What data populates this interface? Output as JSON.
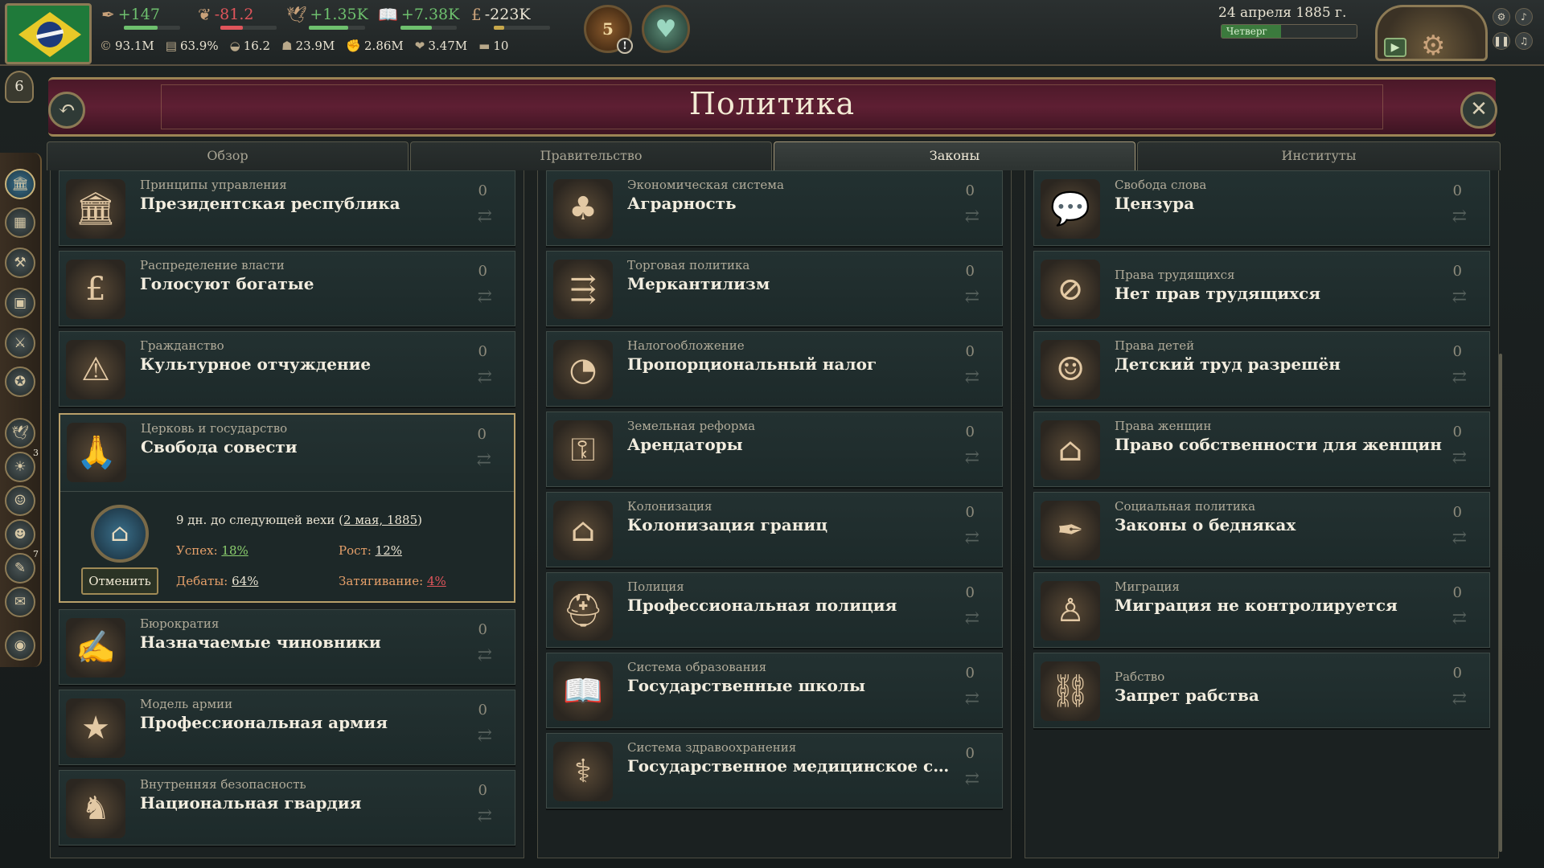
{
  "topbar": {
    "country_flag": "brazil-flag",
    "resources": [
      {
        "icon": "authority-icon",
        "value": "+147",
        "color": "#6ec06e"
      },
      {
        "icon": "bureaucracy-icon",
        "value": "-81.2",
        "color": "#e0555b"
      },
      {
        "icon": "influence-icon",
        "value": "+1.35K",
        "color": "#6ec06e"
      },
      {
        "icon": "innovation-icon",
        "value": "+7.38K",
        "color": "#6ec06e"
      },
      {
        "icon": "treasury-icon",
        "value": "-223K",
        "color": "#e9e3d2"
      }
    ],
    "stats": [
      {
        "icon": "gdp-icon",
        "value": "93.1M"
      },
      {
        "icon": "literacy-icon",
        "value": "63.9%"
      },
      {
        "icon": "sol-icon",
        "value": "16.2"
      },
      {
        "icon": "population-icon",
        "value": "23.9M"
      },
      {
        "icon": "loyalists-icon",
        "value": "2.86M"
      },
      {
        "icon": "radicals-icon",
        "value": "3.47M"
      },
      {
        "icon": "army-icon",
        "value": "10"
      }
    ],
    "journal_count": "5",
    "date": "24 апреля 1885 г.",
    "weekday": "Четверг",
    "rank": "6"
  },
  "page": {
    "title": "Политика"
  },
  "tabs": [
    {
      "label": "Обзор",
      "active": false
    },
    {
      "label": "Правительство",
      "active": false
    },
    {
      "label": "Законы",
      "active": true
    },
    {
      "label": "Институты",
      "active": false
    }
  ],
  "columns": [
    {
      "laws": [
        {
          "category": "Принципы управления",
          "name": "Президентская республика",
          "count": "0",
          "icon": "institution-icon"
        },
        {
          "category": "Распределение власти",
          "name": "Голосуют богатые",
          "count": "0",
          "icon": "pound-icon"
        },
        {
          "category": "Гражданство",
          "name": "Культурное отчуждение",
          "count": "0",
          "icon": "hand-warning-icon"
        },
        {
          "category": "Бюрократия",
          "name": "Назначаемые чиновники",
          "count": "0",
          "icon": "quill-hand-icon"
        },
        {
          "category": "Модель армии",
          "name": "Профессиональная армия",
          "count": "0",
          "icon": "star-medal-icon"
        },
        {
          "category": "Внутренняя безопасность",
          "name": "Национальная гвардия",
          "count": "0",
          "icon": "soldiers-icon"
        }
      ],
      "expanded": {
        "category": "Церковь и государство",
        "name": "Свобода совести",
        "count": "0",
        "icon": "praying-hands-icon",
        "milestone_text": "9 дн. до следующей вехи (",
        "milestone_date": "2 мая, 1885",
        "milestone_end": ")",
        "success_label": "Успех:",
        "success_value": "18%",
        "growth_label": "Рост:",
        "growth_value": "12%",
        "debate_label": "Дебаты:",
        "debate_value": "64%",
        "stall_label": "Затягивание:",
        "stall_value": "4%",
        "cancel_label": "Отменить"
      }
    },
    {
      "laws": [
        {
          "category": "Экономическая система",
          "name": "Аграрность",
          "count": "0",
          "icon": "farmer-icon"
        },
        {
          "category": "Торговая политика",
          "name": "Меркантилизм",
          "count": "0",
          "icon": "trade-arrows-icon"
        },
        {
          "category": "Налогообложение",
          "name": "Пропорциональный налог",
          "count": "0",
          "icon": "pie-icon"
        },
        {
          "category": "Земельная реформа",
          "name": "Арендаторы",
          "count": "0",
          "icon": "key-hand-icon"
        },
        {
          "category": "Колонизация",
          "name": "Колонизация границ",
          "count": "0",
          "icon": "house-icon"
        },
        {
          "category": "Полиция",
          "name": "Профессиональная полиция",
          "count": "0",
          "icon": "police-helmet-icon"
        },
        {
          "category": "Система образования",
          "name": "Государственные школы",
          "count": "0",
          "icon": "book-icon"
        },
        {
          "category": "Система здравоохранения",
          "name": "Государственное медицинское страхова ...",
          "count": "0",
          "icon": "caduceus-icon"
        }
      ]
    },
    {
      "laws": [
        {
          "category": "Свобода слова",
          "name": "Цензура",
          "count": "0",
          "icon": "speech-bubble-icon"
        },
        {
          "category": "Права трудящихся",
          "name": "Нет прав трудящихся",
          "count": "0",
          "icon": "no-workers-icon"
        },
        {
          "category": "Права детей",
          "name": "Детский труд разрешён",
          "count": "0",
          "icon": "child-icon"
        },
        {
          "category": "Права женщин",
          "name": "Право собственности для женщин",
          "count": "0",
          "icon": "building-icon"
        },
        {
          "category": "Социальная политика",
          "name": "Законы о бедняках",
          "count": "0",
          "icon": "feather-icon"
        },
        {
          "category": "Миграция",
          "name": "Миграция не контролируется",
          "count": "0",
          "icon": "migrant-icon"
        },
        {
          "category": "Рабство",
          "name": "Запрет рабства",
          "count": "0",
          "icon": "broken-chain-icon"
        }
      ]
    }
  ],
  "sidebar": {
    "items": [
      {
        "icon": "politics-icon",
        "active": true,
        "badge": ""
      },
      {
        "icon": "budget-icon",
        "active": false,
        "badge": ""
      },
      {
        "icon": "production-icon",
        "active": false,
        "badge": ""
      },
      {
        "icon": "market-icon",
        "active": false,
        "badge": ""
      },
      {
        "icon": "military-icon",
        "active": false,
        "badge": ""
      },
      {
        "icon": "diplomacy-icon",
        "active": false,
        "badge": ""
      },
      {
        "icon": "influence-bird-icon",
        "active": false,
        "badge": ""
      },
      {
        "icon": "tech-icon",
        "active": false,
        "badge": "3"
      },
      {
        "icon": "culture-icon",
        "active": false,
        "badge": ""
      },
      {
        "icon": "population-icon",
        "active": false,
        "badge": ""
      },
      {
        "icon": "journal-icon",
        "active": false,
        "badge": "7"
      },
      {
        "icon": "briefcase-icon",
        "active": false,
        "badge": ""
      },
      {
        "icon": "world-icon",
        "active": false,
        "badge": ""
      }
    ]
  }
}
